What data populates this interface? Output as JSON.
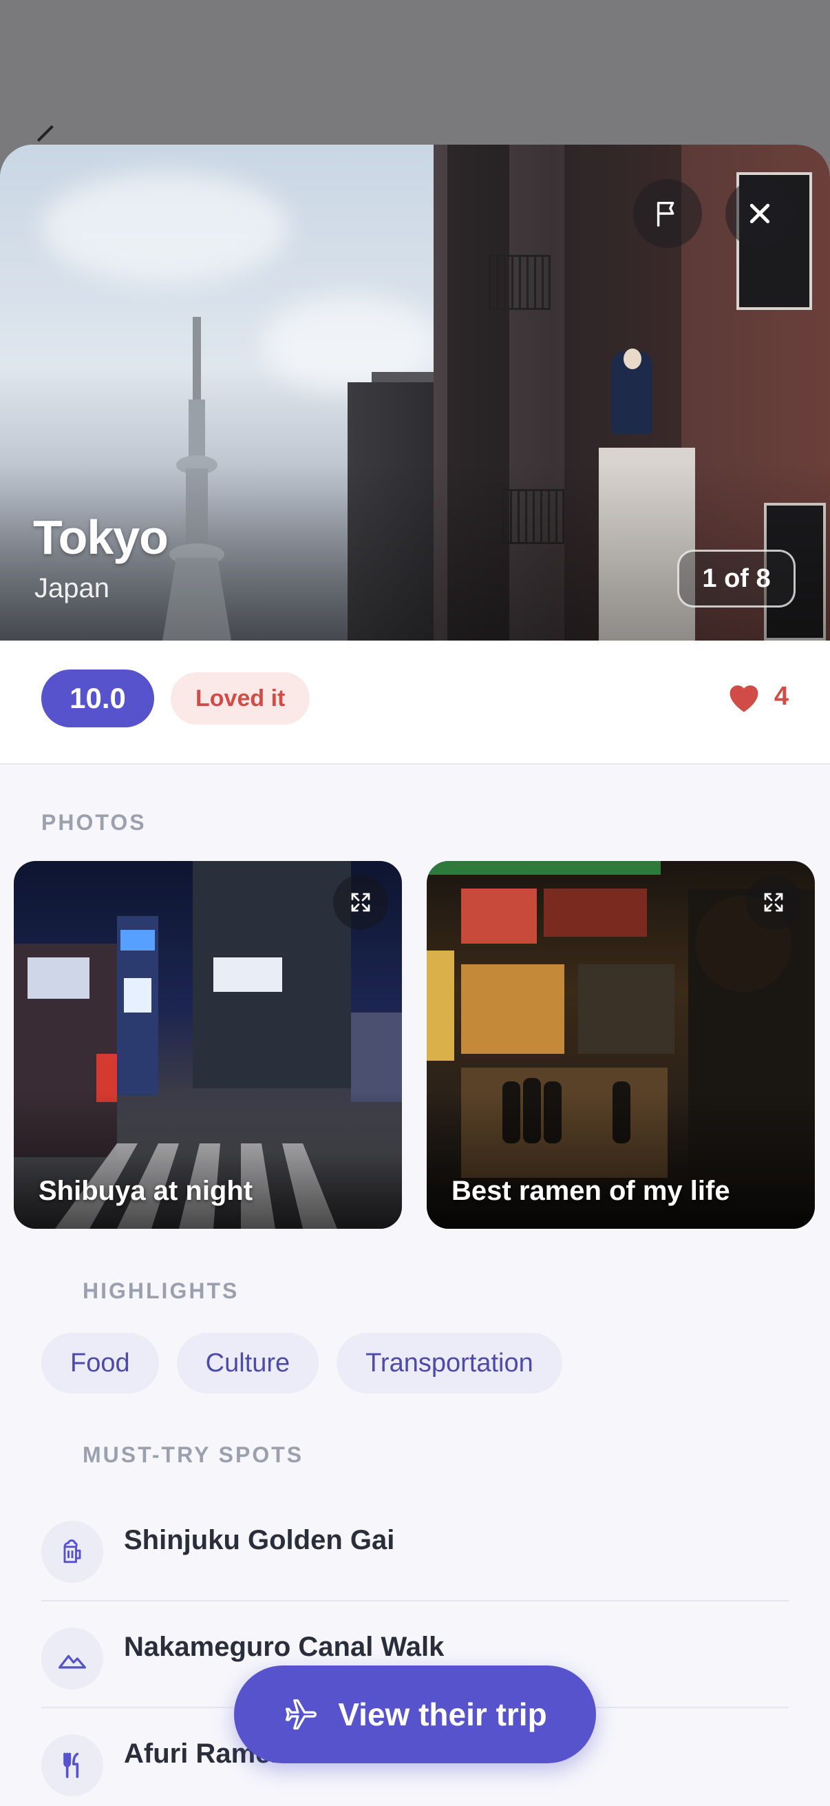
{
  "hero": {
    "city": "Tokyo",
    "country": "Japan",
    "counter": "1 of 8"
  },
  "rating": {
    "score": "10.0",
    "verdict": "Loved it",
    "likes": "4"
  },
  "photos": {
    "label": "PHOTOS",
    "items": [
      {
        "caption": "Shibuya at night"
      },
      {
        "caption": "Best ramen of my life"
      }
    ]
  },
  "highlights": {
    "label": "HIGHLIGHTS",
    "chips": [
      "Food",
      "Culture",
      "Transportation"
    ]
  },
  "spots": {
    "label": "MUST-TRY SPOTS",
    "items": [
      {
        "name": "Shinjuku Golden Gai",
        "icon": "beer-mug-icon"
      },
      {
        "name": "Nakameguro Canal Walk",
        "icon": "mountain-icon"
      },
      {
        "name": "Afuri Ramen",
        "icon": "fork-knife-icon"
      }
    ]
  },
  "cta": {
    "label": "View their trip",
    "icon": "airplane-icon"
  },
  "colors": {
    "accent": "#5653cc",
    "love": "#d24c47",
    "chip_bg": "#ececf8"
  }
}
